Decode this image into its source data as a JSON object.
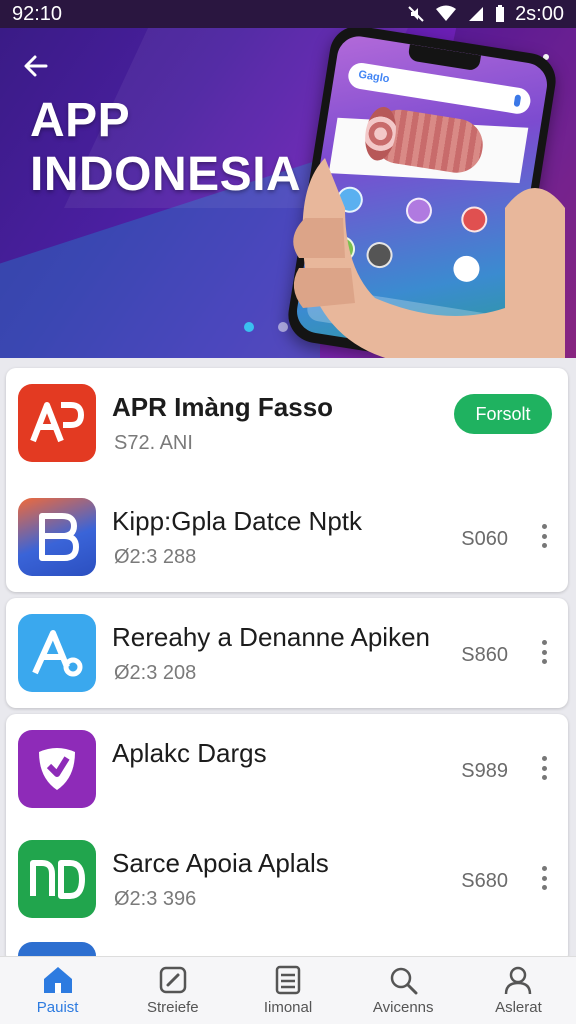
{
  "status_bar": {
    "time_left": "92:10",
    "time_right": "2s:00"
  },
  "hero": {
    "title_line1": "APP",
    "title_line2": "INDONESIA",
    "phone_search_text": "Gaglo"
  },
  "featured": {
    "title": "APR  Imàng Fasso",
    "subtitle": "S72. ANI",
    "button_label": "Forsolt",
    "accent": "#1fb260"
  },
  "apps": [
    {
      "title": "Kipp:Gpla Datce Nptk",
      "subtitle": "Ø2:3 288",
      "price": "S060",
      "icon": "b-letter-icon",
      "color": "#3a64d8"
    },
    {
      "title": "Rereahy a Denanne Apiken",
      "subtitle": "Ø2:3 208",
      "price": "S860",
      "icon": "a-letter-icon",
      "color": "#3aa8ee"
    },
    {
      "title": "Aplakc Dargs",
      "subtitle": "",
      "price": "S989",
      "icon": "shield-check-icon",
      "color": "#8e2bb8"
    },
    {
      "title": "Sarce Apoia Aplals",
      "subtitle": "Ø2:3 396",
      "price": "S680",
      "icon": "nd-letters-icon",
      "color": "#21a54d"
    }
  ],
  "bottom_nav": [
    {
      "label": "Pauist",
      "icon": "home-icon",
      "active": true
    },
    {
      "label": "Streiefe",
      "icon": "edit-icon",
      "active": false
    },
    {
      "label": "Iimonal",
      "icon": "list-icon",
      "active": false
    },
    {
      "label": "Avicenns",
      "icon": "search-icon",
      "active": false
    },
    {
      "label": "Aslerat",
      "icon": "user-icon",
      "active": false
    }
  ],
  "colors": {
    "active_nav": "#2d7be0",
    "hero_start": "#3a1b86",
    "hero_end": "#a62c9c"
  }
}
